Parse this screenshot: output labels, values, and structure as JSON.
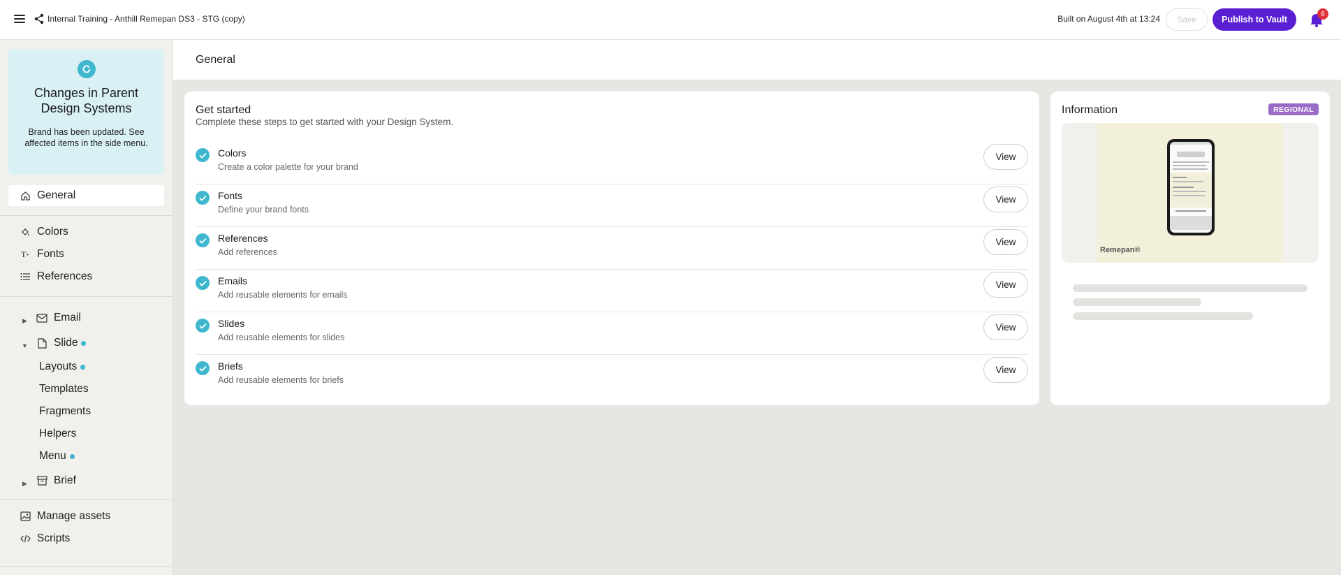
{
  "header": {
    "title": "Internal Training - Anthill Remepan DS3 - STG (copy)",
    "built_on": "Built on August 4th at 13:24",
    "save_label": "Save",
    "publish_label": "Publish to Vault",
    "notification_count": "6"
  },
  "notice": {
    "title": "Changes in Parent Design Systems",
    "body": "Brand has been updated. See affected items in the side menu."
  },
  "sidebar": {
    "general": "General",
    "colors": "Colors",
    "fonts": "Fonts",
    "references": "References",
    "email": "Email",
    "slide": "Slide",
    "layouts": "Layouts",
    "templates": "Templates",
    "fragments": "Fragments",
    "helpers": "Helpers",
    "menu": "Menu",
    "brief": "Brief",
    "manage_assets": "Manage assets",
    "scripts": "Scripts"
  },
  "page": {
    "title": "General"
  },
  "get_started": {
    "title": "Get started",
    "subtitle": "Complete these steps to get started with your Design System.",
    "view_label": "View",
    "steps": [
      {
        "name": "Colors",
        "desc": "Create a color palette for your brand"
      },
      {
        "name": "Fonts",
        "desc": "Define your brand fonts"
      },
      {
        "name": "References",
        "desc": "Add references"
      },
      {
        "name": "Emails",
        "desc": "Add reusable elements for emails"
      },
      {
        "name": "Slides",
        "desc": "Add reusable elements for slides"
      },
      {
        "name": "Briefs",
        "desc": "Add reusable elements for briefs"
      }
    ]
  },
  "information": {
    "title": "Information",
    "badge": "REGIONAL",
    "brand_mark": "Remepan®"
  },
  "colors": {
    "accent": "#5b1fd3",
    "teal": "#3fb7cf",
    "badge": "#9a6bc7"
  }
}
